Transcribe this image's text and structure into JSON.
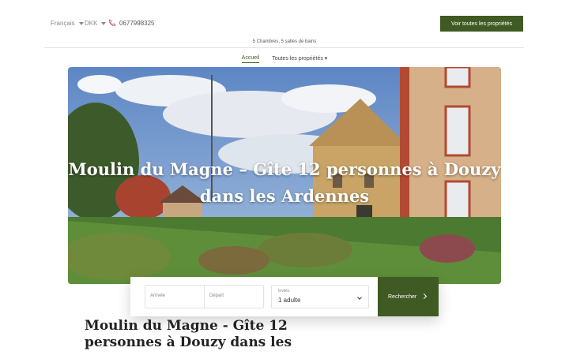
{
  "header": {
    "language": "Français",
    "currency": "DKK",
    "phone": "0677998325",
    "cta_label": "Voir toutes les propriétés"
  },
  "subtitle": "5 Chambres, 5 salles de bains",
  "nav": {
    "home": "Accueil",
    "all_properties": "Toutes les propriétés ▾"
  },
  "hero": {
    "title": "Moulin du Magne – Gîte 12 personnes à Douzy dans les Ardennes"
  },
  "booking": {
    "arrival_placeholder": "Arrivée",
    "departure_placeholder": "Départ",
    "guests_label": "Invités",
    "guests_value": "1 adulte",
    "search_label": "Rechercher"
  },
  "page_title": "Moulin du Magne - Gîte 12 personnes à Douzy dans les",
  "colors": {
    "brand_green": "#3f5a22"
  },
  "icons": {
    "phone": "phone-icon",
    "caret": "caret-down-icon",
    "chevron": "chevron-down-icon",
    "arrow": "chevron-right-icon"
  }
}
